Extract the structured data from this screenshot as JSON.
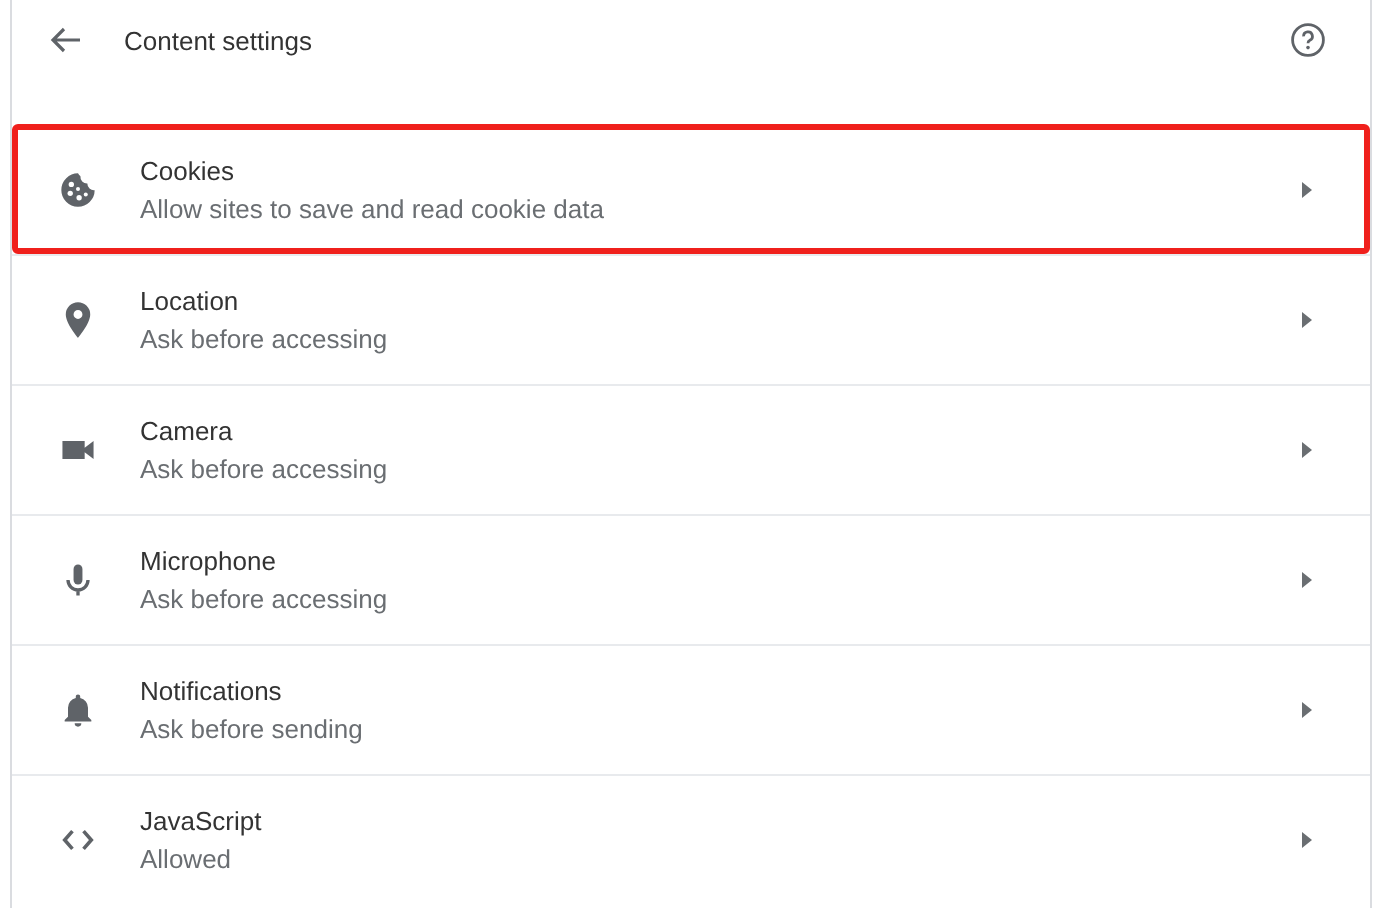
{
  "header": {
    "title": "Content settings"
  },
  "items": [
    {
      "kind": "cookie",
      "title": "Cookies",
      "subtitle": "Allow sites to save and read cookie data",
      "highlighted": true
    },
    {
      "kind": "location",
      "title": "Location",
      "subtitle": "Ask before accessing",
      "highlighted": false
    },
    {
      "kind": "camera",
      "title": "Camera",
      "subtitle": "Ask before accessing",
      "highlighted": false
    },
    {
      "kind": "microphone",
      "title": "Microphone",
      "subtitle": "Ask before accessing",
      "highlighted": false
    },
    {
      "kind": "bell",
      "title": "Notifications",
      "subtitle": "Ask before sending",
      "highlighted": false
    },
    {
      "kind": "code",
      "title": "JavaScript",
      "subtitle": "Allowed",
      "highlighted": false
    }
  ]
}
